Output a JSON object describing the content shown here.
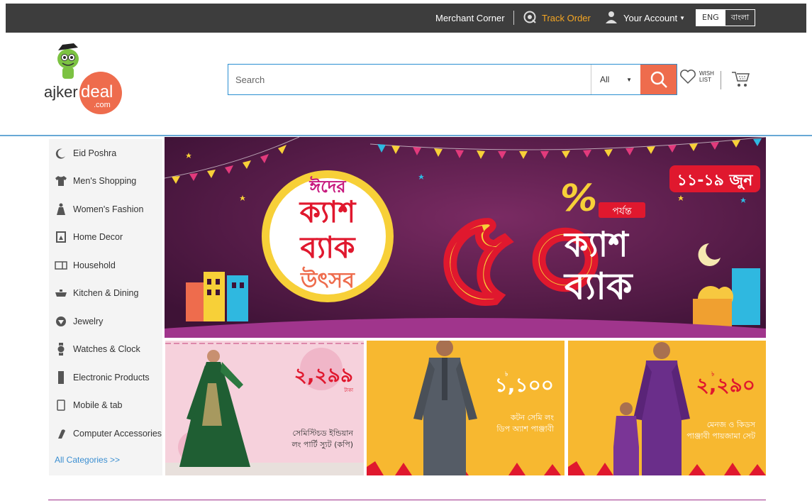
{
  "topbar": {
    "merchant": "Merchant Corner",
    "track": "Track Order",
    "account": "Your Account",
    "lang_en": "ENG",
    "lang_bn": "বাংলা"
  },
  "logo": {
    "text_a": "ajker",
    "text_b": "deal",
    "text_c": ".com"
  },
  "search": {
    "placeholder": "Search",
    "category": "All"
  },
  "wishlist": {
    "line1": "WISH",
    "line2": "LIST"
  },
  "categories": [
    {
      "label": "Eid Poshra",
      "icon": "crescent-icon"
    },
    {
      "label": "Men's Shopping",
      "icon": "shirt-icon"
    },
    {
      "label": "Women's Fashion",
      "icon": "dress-icon"
    },
    {
      "label": "Home Decor",
      "icon": "frame-icon"
    },
    {
      "label": "Household",
      "icon": "cabinet-icon"
    },
    {
      "label": "Kitchen & Dining",
      "icon": "kitchen-icon"
    },
    {
      "label": "Jewelry",
      "icon": "diamond-icon"
    },
    {
      "label": "Watches & Clock",
      "icon": "watch-icon"
    },
    {
      "label": "Electronic Products",
      "icon": "device-icon"
    },
    {
      "label": "Mobile & tab",
      "icon": "mobile-icon"
    },
    {
      "label": "Computer Accessories",
      "icon": "mouse-icon"
    }
  ],
  "all_categories": "All Categories >>",
  "hero": {
    "badge_top": "ঈদের",
    "badge_l1": "ক্যাশ",
    "badge_l2": "ব্যাক",
    "badge_l3": "উৎসব",
    "big_number": "৫০",
    "percent": "%",
    "upto": "পর্যন্ত",
    "cash": "ক্যাশ",
    "back": "ব্যাক",
    "dates": "১১-১৯ জুন"
  },
  "tiles": [
    {
      "price": "২,২৯৯",
      "small": "টাকা",
      "desc1": "সেমিস্টিচড ইন্ডিয়ান",
      "desc2": "লং পার্টি স্যুট (কপি)"
    },
    {
      "price": "১,১০০",
      "small": "৳",
      "desc1": "কটন সেমি লং",
      "desc2": "ডিপ অ্যাশ পাঞ্জাবী"
    },
    {
      "price": "২,২৯০",
      "small": "৳",
      "desc1": "মেনজ ও কিডস",
      "desc2": "পাঞ্জাবী পায়জামা সেট"
    }
  ],
  "colors": {
    "topbar": "#3d3d3d",
    "track": "#f5a623",
    "search_btn": "#ee6c4d",
    "accent_blue": "#2a8fd1",
    "hero_bg": "#5b1d4a",
    "tile_pink": "#f6d1dc",
    "tile_yellow": "#f7b830"
  }
}
